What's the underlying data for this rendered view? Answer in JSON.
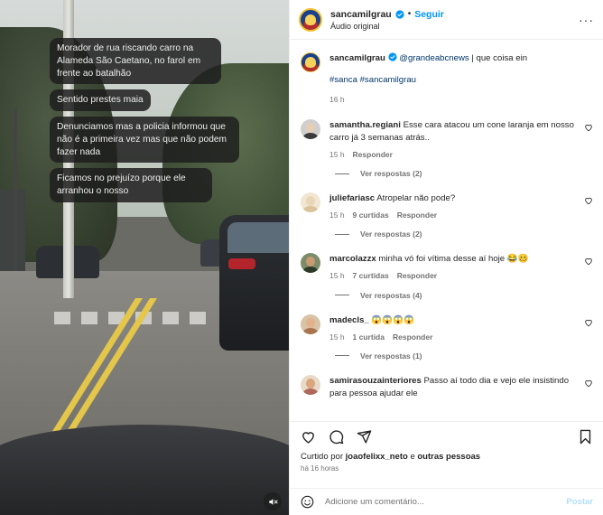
{
  "video": {
    "messages": [
      "Morador de rua riscando carro na Alameda São Caetano, no farol em frente ao batalhão",
      "Sentido prestes maia",
      "Denunciamos mas a policia informou que não é a primeira vez mas que não podem fazer nada",
      "Ficamos no prejuízo porque ele arranhou o nosso"
    ],
    "mute_icon": "speaker-muted-icon"
  },
  "header": {
    "username": "sancamilgrau",
    "separator": "•",
    "follow_label": "Seguir",
    "audio_label": "Áudio original"
  },
  "caption": {
    "username": "sancamilgrau",
    "mention": "@grandeabcnews",
    "text": " | que coisa ein",
    "hashtags": "#sanca #sancamilgrau",
    "time": "16 h"
  },
  "comments": [
    {
      "username": "samantha.regiani",
      "text": "Esse cara atacou um cone laranja em nosso carro já 3 semanas atrás..",
      "time": "15 h",
      "likes": "",
      "reply_label": "Responder",
      "replies_label": "Ver respostas (2)",
      "avatar_colors": [
        "#cfcfcf",
        "#3b3b3b"
      ]
    },
    {
      "username": "juliefariasc",
      "text": "Atropelar não pode?",
      "time": "15 h",
      "likes": "9 curtidas",
      "reply_label": "Responder",
      "replies_label": "Ver respostas (2)",
      "avatar_colors": [
        "#e8d6b8",
        "#f0e6d2"
      ]
    },
    {
      "username": "marcolazzx",
      "text": "minha vó foi vítima desse aí hoje 😂🥴",
      "time": "15 h",
      "likes": "7 curtidas",
      "reply_label": "Responder",
      "replies_label": "Ver respostas (4)",
      "avatar_colors": [
        "#c89a72",
        "#2d3a2a"
      ]
    },
    {
      "username": "madecls_",
      "text": "😱😱😱😱",
      "time": "15 h",
      "likes": "1 curtida",
      "reply_label": "Responder",
      "replies_label": "Ver respostas (1)",
      "avatar_colors": [
        "#e2b28c",
        "#d7c3a6"
      ]
    },
    {
      "username": "samirasouzainteriores",
      "text": "Passo aí todo dia e vejo ele insistindo para pessoa ajudar ele",
      "time": "",
      "likes": "",
      "reply_label": "",
      "replies_label": "",
      "avatar_colors": [
        "#d9a67e",
        "#b0685a"
      ]
    }
  ],
  "actions": {
    "liked_prefix": "Curtido por ",
    "liked_user": "joaofelixx_neto",
    "liked_suffix": " e ",
    "liked_others": "outras pessoas",
    "time_ago": "há 16 horas"
  },
  "composer": {
    "placeholder": "Adicione um comentário...",
    "post_label": "Postar"
  }
}
